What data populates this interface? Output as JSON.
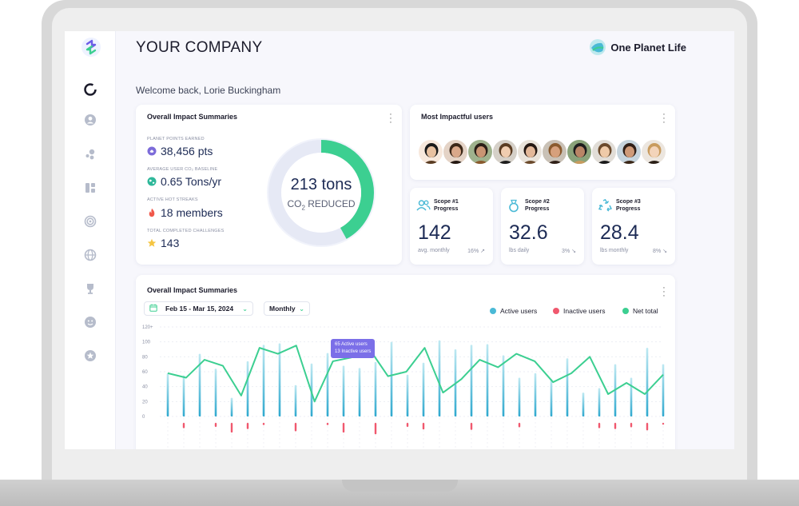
{
  "header": {
    "company": "YOUR COMPANY",
    "brand_name": "One Planet Life",
    "welcome": "Welcome back, Lorie Buckingham"
  },
  "sidebar": {
    "items": [
      {
        "icon": "progress-ring-icon",
        "active": true
      },
      {
        "icon": "user-icon",
        "active": false
      },
      {
        "icon": "bubbles-icon",
        "active": false
      },
      {
        "icon": "dashboard-icon",
        "active": false
      },
      {
        "icon": "target-icon",
        "active": false
      },
      {
        "icon": "globe-icon",
        "active": false
      },
      {
        "icon": "trophy-icon",
        "active": false
      },
      {
        "icon": "face-icon",
        "active": false
      },
      {
        "icon": "star-icon",
        "active": false
      }
    ]
  },
  "summary": {
    "title": "Overall Impact Summaries",
    "stats": [
      {
        "label": "PLANET POINTS EARNED",
        "value": "38,456 pts",
        "icon": "leaf-badge-icon",
        "color": "#7c6bd9"
      },
      {
        "label": "AVERAGE USER CO₂ BASELINE",
        "value": "0.65 Tons/yr",
        "icon": "earth-icon",
        "color": "#2fb89a"
      },
      {
        "label": "ACTIVE HOT STREAKS",
        "value": "18 members",
        "icon": "flame-icon",
        "color": "#f0584a"
      },
      {
        "label": "TOTAL COMPLETED CHALLENGES",
        "value": "143",
        "icon": "star-icon",
        "color": "#f5c542"
      }
    ],
    "donut_value": "213 tons",
    "donut_label_prefix": "CO",
    "donut_label_sub": "2",
    "donut_label_suffix": " REDUCED",
    "donut_fraction": 0.42
  },
  "users_card": {
    "title": "Most Impactful users",
    "avatar_count": 10
  },
  "scopes": [
    {
      "label": "Scope #1 Progress",
      "value": "142",
      "foot": "avg. monthly",
      "pct": "16%",
      "trend": "up",
      "icon": "users-icon"
    },
    {
      "label": "Scope #2 Progress",
      "value": "32.6",
      "foot": "lbs daily",
      "pct": "3%",
      "trend": "down",
      "icon": "ring-icon"
    },
    {
      "label": "Scope #3 Progress",
      "value": "28.4",
      "foot": "lbs monthly",
      "pct": "8%",
      "trend": "down",
      "icon": "recycle-icon"
    }
  ],
  "chart_card": {
    "title": "Overall Impact Summaries",
    "date_range": "Feb 15 - Mar 15, 2024",
    "period": "Monthly",
    "legend": [
      {
        "name": "Active users",
        "color": "#4ab9d6"
      },
      {
        "name": "Inactive users",
        "color": "#f0586e"
      },
      {
        "name": "Net total",
        "color": "#3ccf91"
      }
    ],
    "tooltip_line1": "65 Active users",
    "tooltip_line2": "13 Inactive users"
  },
  "chart_data": {
    "type": "bar",
    "yticks": [
      "120+",
      "100",
      "80",
      "60",
      "40",
      "20",
      "0"
    ],
    "ylim": [
      0,
      120
    ],
    "series": [
      {
        "name": "Active users",
        "values": [
          58,
          55,
          84,
          64,
          25,
          74,
          96,
          98,
          42,
          71,
          85,
          68,
          65,
          73,
          100,
          56,
          72,
          102,
          90,
          96,
          97,
          82,
          52,
          58,
          50,
          78,
          32,
          38,
          70,
          52,
          92,
          70
        ]
      },
      {
        "name": "Inactive users",
        "values": [
          0,
          12,
          0,
          9,
          22,
          14,
          5,
          0,
          19,
          0,
          5,
          22,
          0,
          26,
          0,
          9,
          15,
          0,
          0,
          16,
          0,
          0,
          10,
          0,
          0,
          0,
          0,
          12,
          14,
          10,
          17,
          4
        ]
      },
      {
        "name": "Net total",
        "values": [
          58,
          52,
          76,
          68,
          28,
          92,
          84,
          95,
          20,
          74,
          79,
          90,
          54,
          60,
          92,
          32,
          50,
          76,
          66,
          84,
          74,
          46,
          58,
          80,
          30,
          45,
          30,
          56
        ]
      }
    ]
  }
}
